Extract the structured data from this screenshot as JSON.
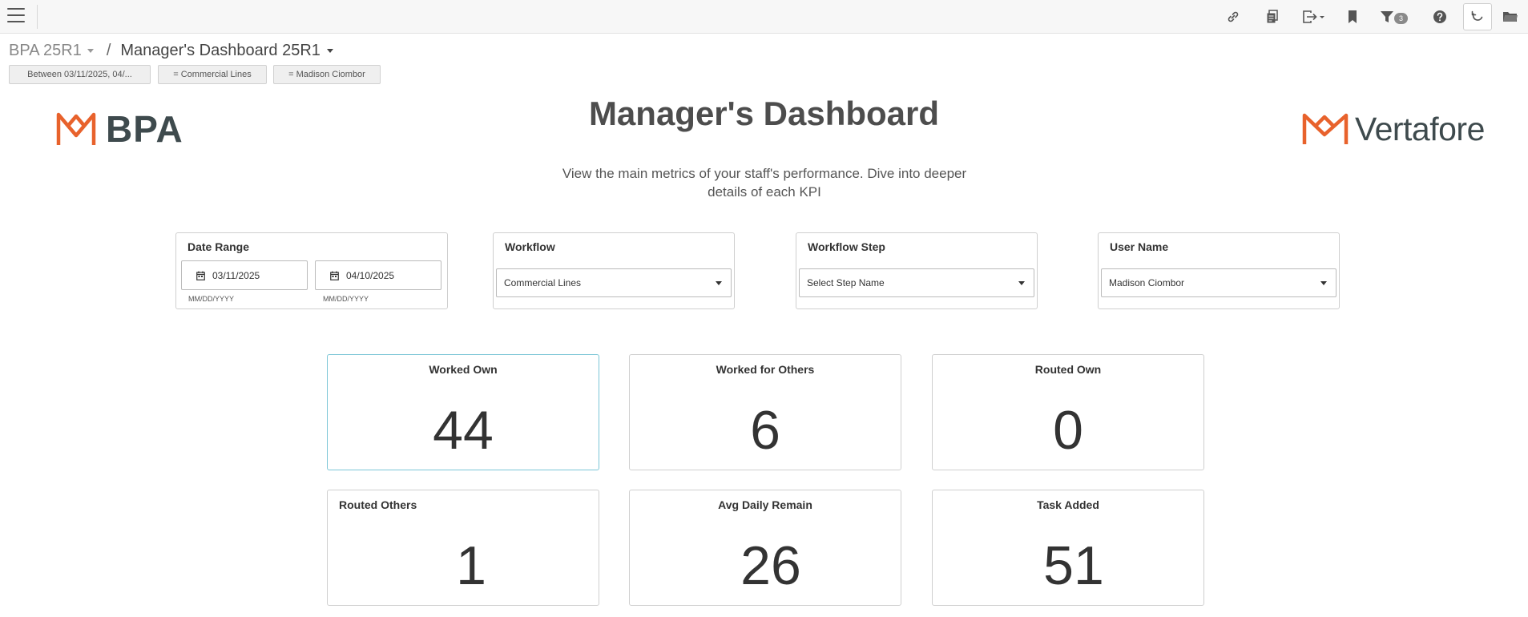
{
  "toolbar": {
    "filter_count": "3"
  },
  "breadcrumb": {
    "root": "BPA 25R1",
    "separator": "/",
    "current": "Manager's Dashboard 25R1"
  },
  "filter_chips": [
    "Between 03/11/2025, 04/...",
    "= Commercial Lines",
    "= Madison Ciombor"
  ],
  "logos": {
    "left": "BPA",
    "right": "Vertafore",
    "accent": "#e8622c"
  },
  "header": {
    "title": "Manager's Dashboard",
    "subtitle_line1": "View the main metrics of your staff's performance. Dive into deeper",
    "subtitle_line2": "details of each KPI"
  },
  "filters": {
    "date_range": {
      "label": "Date Range",
      "start": "03/11/2025",
      "end": "04/10/2025",
      "format_hint": "MM/DD/YYYY"
    },
    "workflow": {
      "label": "Workflow",
      "value": "Commercial Lines"
    },
    "workflow_step": {
      "label": "Workflow Step",
      "value": "Select Step Name"
    },
    "user_name": {
      "label": "User Name",
      "value": "Madison Ciombor"
    }
  },
  "kpis": [
    {
      "label": "Worked Own",
      "value": "44"
    },
    {
      "label": "Worked for Others",
      "value": "6"
    },
    {
      "label": "Routed Own",
      "value": "0"
    },
    {
      "label": "Routed Others",
      "value": "1"
    },
    {
      "label": "Avg Daily Remain",
      "value": "26"
    },
    {
      "label": "Task Added",
      "value": "51"
    }
  ],
  "colors": {
    "active_card_border": "#7cc6d6",
    "logo_text": "#3e4a4d"
  },
  "icons": [
    "menu-icon",
    "link-icon",
    "copy-icon",
    "export-icon",
    "bookmark-icon",
    "filter-icon",
    "help-icon",
    "refresh-icon",
    "folder-icon",
    "calendar-icon",
    "chevron-down-icon"
  ]
}
